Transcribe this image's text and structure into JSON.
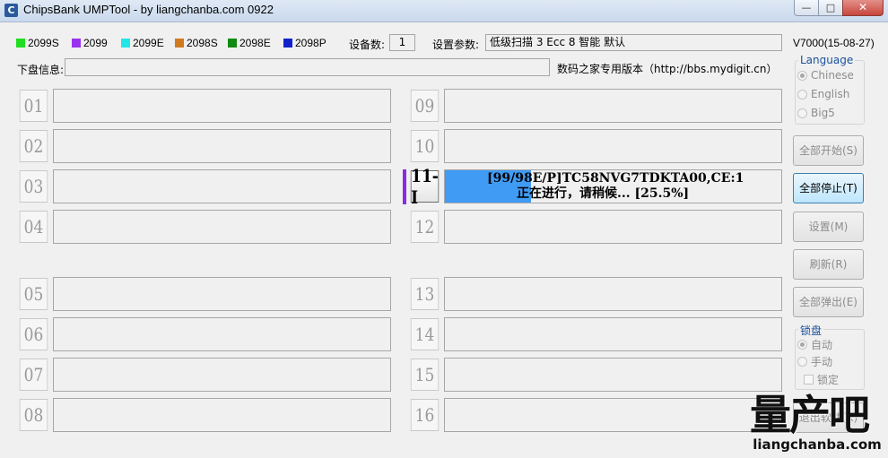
{
  "window": {
    "title": "ChipsBank UMPTool - by liangchanba.com 0922",
    "app_icon": "C",
    "minimize_glyph": "—",
    "maximize_glyph": "□",
    "close_glyph": "✕"
  },
  "legend": [
    {
      "label": "2099S",
      "color": "#22dd22"
    },
    {
      "label": "2099",
      "color": "#9933ee"
    },
    {
      "label": "2099E",
      "color": "#22e6e6"
    },
    {
      "label": "2098S",
      "color": "#d07a1e"
    },
    {
      "label": "2098E",
      "color": "#118a11"
    },
    {
      "label": "2098P",
      "color": "#1122cc"
    }
  ],
  "device_count": {
    "label": "设备数:",
    "value": "1"
  },
  "settings_param": {
    "label": "设置参数:",
    "value": "低级扫描 3 Ecc 8 智能 默认"
  },
  "version": "V7000(15-08-27)",
  "udisk_info": {
    "label": "下盘信息:",
    "value": ""
  },
  "edition_text": "数码之家专用版本（http://bbs.mydigit.cn）",
  "ports": [
    {
      "num": "01"
    },
    {
      "num": "02"
    },
    {
      "num": "03"
    },
    {
      "num": "04"
    },
    {
      "num": "05"
    },
    {
      "num": "06"
    },
    {
      "num": "07"
    },
    {
      "num": "08"
    },
    {
      "num": "09"
    },
    {
      "num": "10"
    },
    {
      "num": "11-I"
    },
    {
      "num": "12"
    },
    {
      "num": "13"
    },
    {
      "num": "14"
    },
    {
      "num": "15"
    },
    {
      "num": "16"
    }
  ],
  "active_port": {
    "line1": "[99/98E/P]TC58NVG7TDKTA00,CE:1",
    "line2": "正在进行，请稍候... [25.5%]",
    "progress_fraction": 0.255,
    "marker_color": "#8a2be2",
    "fill_color": "#3f9bf4"
  },
  "language": {
    "title": "Language",
    "options": [
      {
        "label": "Chinese",
        "checked": true
      },
      {
        "label": "English",
        "checked": false
      },
      {
        "label": "Big5",
        "checked": false
      }
    ]
  },
  "buttons": {
    "start_all": "全部开始(S)",
    "stop_all": "全部停止(T)",
    "settings": "设置(M)",
    "refresh": "刷新(R)",
    "eject_all": "全部弹出(E)",
    "exit": "退出软件(X)"
  },
  "lock": {
    "title": "锁盘",
    "auto": "自动",
    "manual": "手动",
    "locked": "锁定"
  },
  "watermark": {
    "logo": "量产吧",
    "url": "liangchanba.com"
  }
}
